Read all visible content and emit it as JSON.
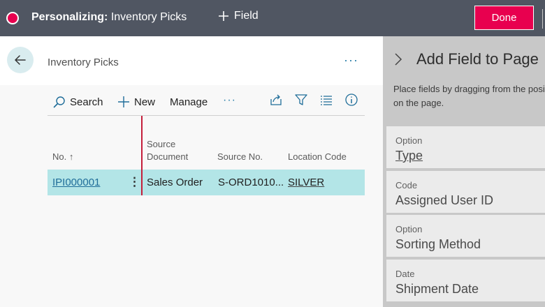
{
  "topbar": {
    "mode_label": "Personalizing:",
    "page_name": "Inventory Picks",
    "add_field_label": "Field",
    "done_label": "Done"
  },
  "header": {
    "title": "Inventory Picks",
    "more_label": "···"
  },
  "actions": {
    "search": "Search",
    "new": "New",
    "manage": "Manage",
    "more": "···"
  },
  "columns": {
    "no": "No. ↑",
    "source_document_line1": "Source",
    "source_document_line2": "Document",
    "source_no": "Source No.",
    "location_code": "Location Code"
  },
  "rows": [
    {
      "no": "IPI000001",
      "source_document": "Sales Order",
      "source_no": "S-ORD1010...",
      "location_code": "SILVER"
    }
  ],
  "pane": {
    "title": "Add Field to Page",
    "description": "Place fields by dragging from the position on the page.",
    "fields": [
      {
        "caption": "Option",
        "name": "Type"
      },
      {
        "caption": "Code",
        "name": "Assigned User ID"
      },
      {
        "caption": "Option",
        "name": "Sorting Method"
      },
      {
        "caption": "Date",
        "name": "Shipment Date"
      }
    ]
  },
  "colors": {
    "topbar": "#505662",
    "accent": "#e8004f",
    "selected_row": "#b3e5e7",
    "link": "#1f6d99",
    "red_marker": "#c41e3a"
  }
}
